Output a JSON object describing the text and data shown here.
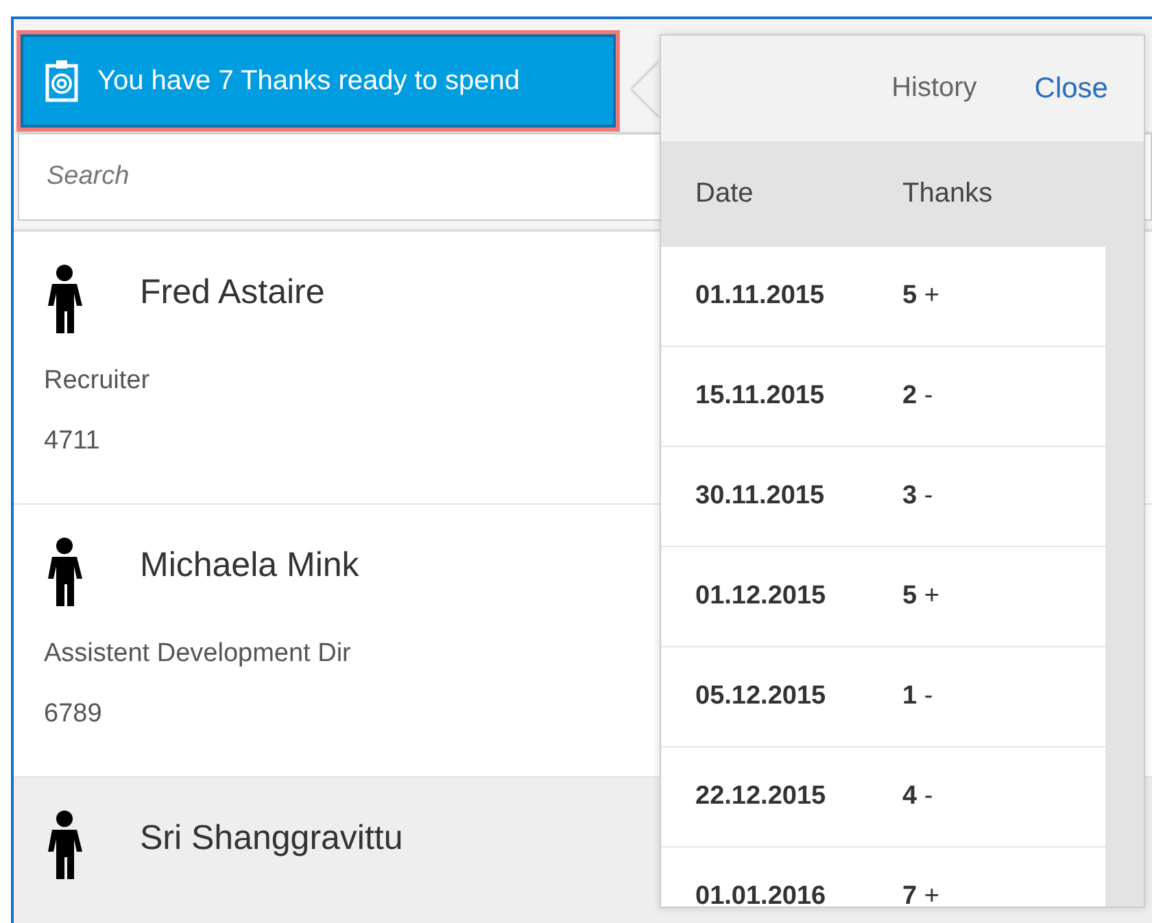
{
  "thanks_button": {
    "label": "You have 7 Thanks ready to spend"
  },
  "search": {
    "placeholder": "Search"
  },
  "people": [
    {
      "name": "Fred Astaire",
      "role": "Recruiter",
      "number": "4711",
      "selected": false
    },
    {
      "name": "Michaela Mink",
      "role": "Assistent Development Dir",
      "number": "6789",
      "selected": false
    },
    {
      "name": "Sri Shanggravittu",
      "selected": true
    }
  ],
  "popover": {
    "title": "History",
    "close": "Close",
    "columns": [
      "Date",
      "Thanks"
    ],
    "rows": [
      {
        "date": "01.11.2015",
        "amount": "5",
        "sign": "+"
      },
      {
        "date": "15.11.2015",
        "amount": "2",
        "sign": "-"
      },
      {
        "date": "30.11.2015",
        "amount": "3",
        "sign": "-"
      },
      {
        "date": "01.12.2015",
        "amount": "5",
        "sign": "+"
      },
      {
        "date": "05.12.2015",
        "amount": "1",
        "sign": "-"
      },
      {
        "date": "22.12.2015",
        "amount": "4",
        "sign": "-"
      },
      {
        "date": "01.01.2016",
        "amount": "7",
        "sign": "+"
      }
    ]
  }
}
